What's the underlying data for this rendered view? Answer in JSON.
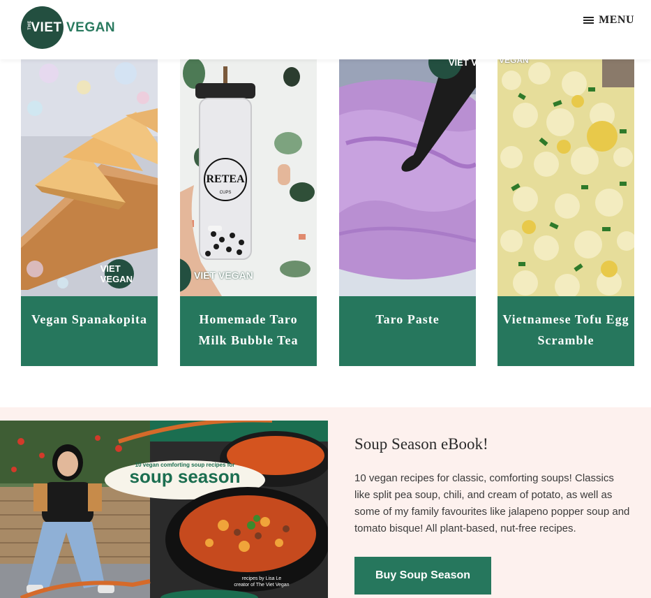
{
  "header": {
    "logo_the": "THE",
    "logo_viet": "VIET",
    "logo_vegan": "VEGAN",
    "menu_label": "MENU"
  },
  "recipes": [
    {
      "title": "Vegan Spanakopita",
      "watermark": "VIET VEGAN"
    },
    {
      "title": "Homemade Taro Milk Bubble Tea",
      "watermark": "VIET VEGAN",
      "cup_text": "RETEA",
      "cup_sub": "CUPS"
    },
    {
      "title": "Taro Paste",
      "watermark": "VIET V"
    },
    {
      "title": "Vietnamese Tofu Egg Scramble",
      "watermark": "VEGAN"
    }
  ],
  "promo": {
    "heading": "Soup Season eBook!",
    "text": "10 vegan recipes for classic, comforting soups! Classics like split pea soup, chili, and cream of potato, as well as some of my family favourites like jalapeno popper soup and tomato bisque! All plant-based, nut-free recipes.",
    "button_label": "Buy Soup Season",
    "cover_tagline": "10 vegan comforting soup recipes for",
    "cover_title": "soup season",
    "cover_credit_1": "recipes by Lisa Le",
    "cover_credit_2": "creator of The Viet Vegan"
  },
  "colors": {
    "brand_green": "#26775d",
    "logo_dark": "#234f40",
    "promo_bg": "#fdf1ee"
  },
  "icons": [
    "hamburger-icon",
    "logo-circle"
  ]
}
